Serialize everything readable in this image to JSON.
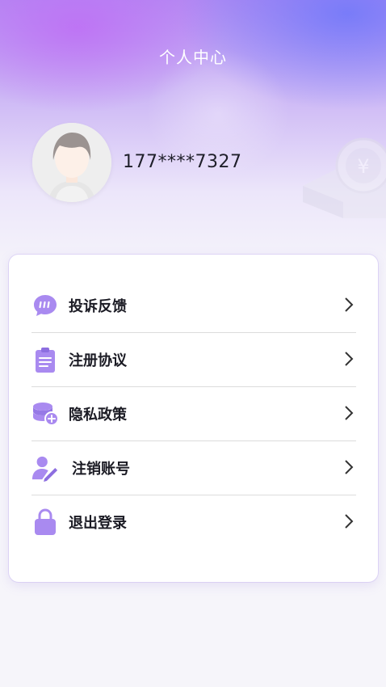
{
  "header": {
    "title": "个人中心"
  },
  "profile": {
    "phone": "177****7327"
  },
  "menu": [
    {
      "label": "投诉反馈",
      "icon": "chat-bubble-icon"
    },
    {
      "label": "注册协议",
      "icon": "clipboard-icon"
    },
    {
      "label": "隐私政策",
      "icon": "database-icon"
    },
    {
      "label": "注销账号",
      "icon": "user-edit-icon"
    },
    {
      "label": "退出登录",
      "icon": "lock-icon"
    }
  ],
  "colors": {
    "accent": "#a98af0",
    "text": "#1b1b24"
  }
}
